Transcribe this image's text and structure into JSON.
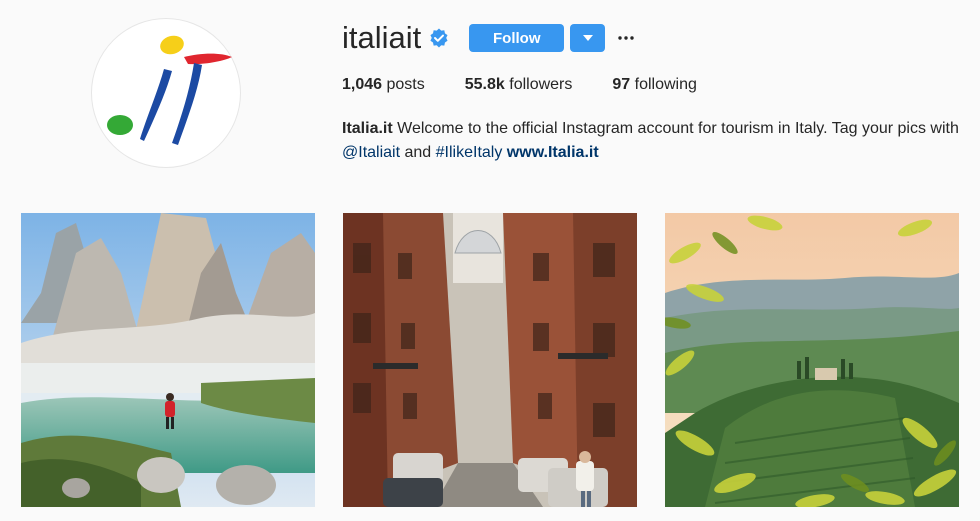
{
  "profile": {
    "username": "italiait",
    "follow_label": "Follow",
    "more_label": "···",
    "stats": {
      "posts_count": "1,046",
      "posts_label": "posts",
      "followers_count": "55.8k",
      "followers_label": "followers",
      "following_count": "97",
      "following_label": "following"
    },
    "bio": {
      "name": "Italia.it",
      "text": " Welcome to the official Instagram account for tourism in Italy. Tag your pics with ",
      "mention": "@Italiait",
      "and": " and ",
      "hashtag": "#IlikeItaly",
      "website": "www.Italia.it"
    }
  },
  "icons": {
    "verified": "verified-badge-icon",
    "dropdown": "chevron-down-icon",
    "more": "more-options-icon"
  },
  "colors": {
    "accent": "#3897f0",
    "link": "#003569",
    "verified": "#3897f0"
  }
}
